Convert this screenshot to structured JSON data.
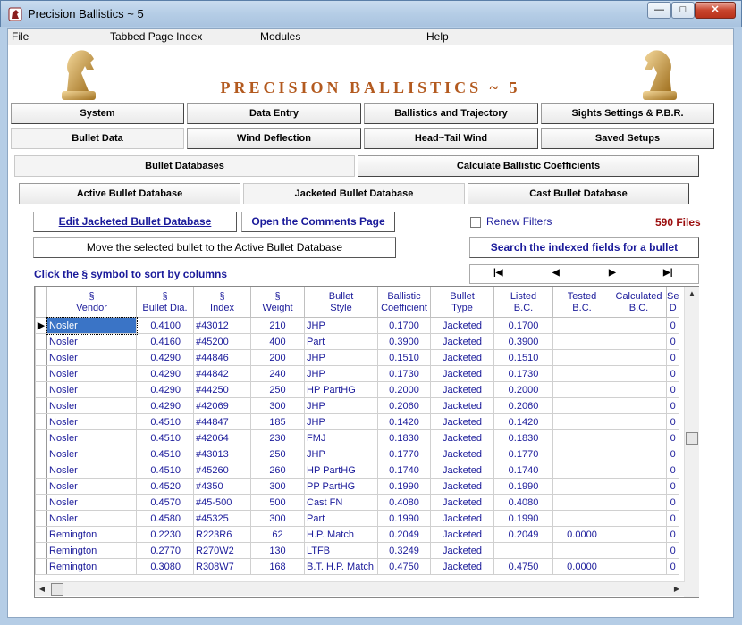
{
  "window": {
    "title": "Precision Ballistics ~ 5",
    "minimize": "—",
    "maximize": "□",
    "close": "✕"
  },
  "menu": {
    "file": "File",
    "tabbed": "Tabbed Page Index",
    "modules": "Modules",
    "help": "Help"
  },
  "header": {
    "title": "PRECISION BALLISTICS ~ 5"
  },
  "main_tabs": {
    "system": "System",
    "data_entry": "Data Entry",
    "ballistics": "Ballistics and Trajectory",
    "sights": "Sights Settings & P.B.R.",
    "bullet_data": "Bullet Data",
    "wind": "Wind Deflection",
    "head_tail": "Head~Tail Wind",
    "saved": "Saved Setups"
  },
  "sub_tabs": {
    "databases": "Bullet Databases",
    "calculate": "Calculate Ballistic Coefficients"
  },
  "db_tabs": {
    "active": "Active Bullet Database",
    "jacketed": "Jacketed Bullet Database",
    "cast": "Cast Bullet Database"
  },
  "buttons": {
    "edit": "Edit Jacketed Bullet Database",
    "comments": "Open the Comments Page",
    "move": "Move the selected bullet to the  Active Bullet Database",
    "search": "Search the indexed fields for a  bullet"
  },
  "filters": {
    "renew": "Renew Filters",
    "files": "590 Files"
  },
  "sort_hint": "Click the   §  symbol to sort  by  columns",
  "nav": {
    "first": "|◀",
    "prev": "◀",
    "next": "▶",
    "last": "▶|"
  },
  "columns": [
    {
      "l1": "§",
      "l2": "Vendor"
    },
    {
      "l1": "§",
      "l2": "Bullet Dia."
    },
    {
      "l1": "§",
      "l2": "Index"
    },
    {
      "l1": "§",
      "l2": "Weight"
    },
    {
      "l1": "Bullet",
      "l2": "Style"
    },
    {
      "l1": "Ballistic",
      "l2": "Coefficient"
    },
    {
      "l1": "Bullet",
      "l2": "Type"
    },
    {
      "l1": "Listed",
      "l2": "B.C."
    },
    {
      "l1": "Tested",
      "l2": "B.C."
    },
    {
      "l1": "Calculated",
      "l2": "B.C."
    },
    {
      "l1": "Se",
      "l2": "D"
    }
  ],
  "rows": [
    [
      "Nosler",
      "0.4100",
      "#43012",
      "210",
      "JHP",
      "0.1700",
      "Jacketed",
      "0.1700",
      "",
      "",
      "0"
    ],
    [
      "Nosler",
      "0.4160",
      "#45200",
      "400",
      "Part",
      "0.3900",
      "Jacketed",
      "0.3900",
      "",
      "",
      "0"
    ],
    [
      "Nosler",
      "0.4290",
      "#44846",
      "200",
      "JHP",
      "0.1510",
      "Jacketed",
      "0.1510",
      "",
      "",
      "0"
    ],
    [
      "Nosler",
      "0.4290",
      "#44842",
      "240",
      "JHP",
      "0.1730",
      "Jacketed",
      "0.1730",
      "",
      "",
      "0"
    ],
    [
      "Nosler",
      "0.4290",
      "#44250",
      "250",
      "HP PartHG",
      "0.2000",
      "Jacketed",
      "0.2000",
      "",
      "",
      "0"
    ],
    [
      "Nosler",
      "0.4290",
      "#42069",
      "300",
      "JHP",
      "0.2060",
      "Jacketed",
      "0.2060",
      "",
      "",
      "0"
    ],
    [
      "Nosler",
      "0.4510",
      "#44847",
      "185",
      "JHP",
      "0.1420",
      "Jacketed",
      "0.1420",
      "",
      "",
      "0"
    ],
    [
      "Nosler",
      "0.4510",
      "#42064",
      "230",
      "FMJ",
      "0.1830",
      "Jacketed",
      "0.1830",
      "",
      "",
      "0"
    ],
    [
      "Nosler",
      "0.4510",
      "#43013",
      "250",
      "JHP",
      "0.1770",
      "Jacketed",
      "0.1770",
      "",
      "",
      "0"
    ],
    [
      "Nosler",
      "0.4510",
      "#45260",
      "260",
      "HP PartHG",
      "0.1740",
      "Jacketed",
      "0.1740",
      "",
      "",
      "0"
    ],
    [
      "Nosler",
      "0.4520",
      "#4350",
      "300",
      "PP PartHG",
      "0.1990",
      "Jacketed",
      "0.1990",
      "",
      "",
      "0"
    ],
    [
      "Nosler",
      "0.4570",
      "#45-500",
      "500",
      "Cast FN",
      "0.4080",
      "Jacketed",
      "0.4080",
      "",
      "",
      "0"
    ],
    [
      "Nosler",
      "0.4580",
      "#45325",
      "300",
      "Part",
      "0.1990",
      "Jacketed",
      "0.1990",
      "",
      "",
      "0"
    ],
    [
      "Remington",
      "0.2230",
      "R223R6",
      "62",
      "H.P. Match",
      "0.2049",
      "Jacketed",
      "0.2049",
      "0.0000",
      "",
      "0"
    ],
    [
      "Remington",
      "0.2770",
      "R270W2",
      "130",
      "LTFB",
      "0.3249",
      "Jacketed",
      "",
      "",
      "",
      "0"
    ],
    [
      "Remington",
      "0.3080",
      "R308W7",
      "168",
      "B.T. H.P. Match",
      "0.4750",
      "Jacketed",
      "0.4750",
      "0.0000",
      "",
      "0"
    ]
  ],
  "colors": {
    "accent_title": "#b35a1f",
    "link_blue": "#1a1a9a",
    "files_red": "#9b0d0d",
    "selection": "#3a74c6"
  }
}
